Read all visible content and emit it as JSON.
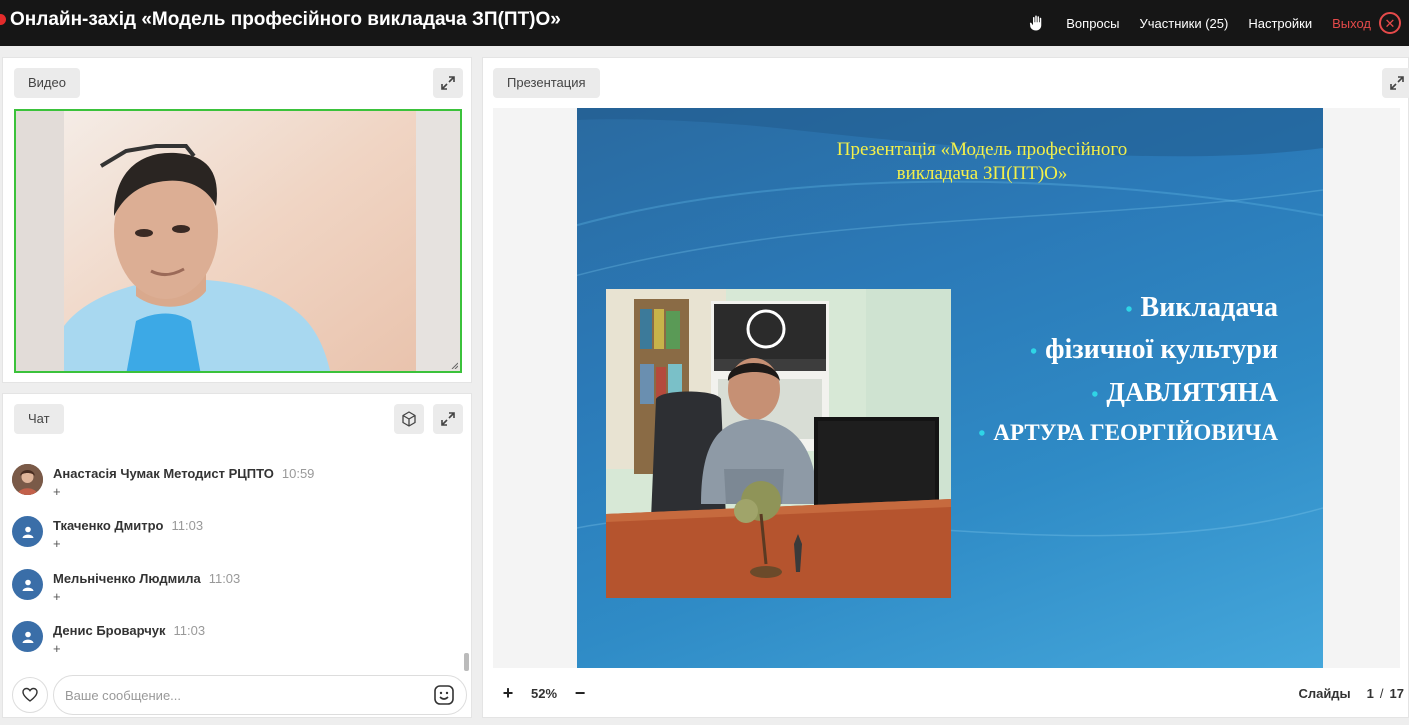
{
  "header": {
    "title": "Онлайн-захід «Модель професійного викладача ЗП(ПТ)О»",
    "nav": {
      "questions": "Вопросы",
      "participants": "Участники (25)",
      "settings": "Настройки",
      "exit": "Выход"
    }
  },
  "video": {
    "label": "Видео"
  },
  "chat": {
    "label": "Чат",
    "messages": [
      {
        "author": "Анастасія Чумак Методист РЦПТО",
        "time": "10:59",
        "text": "+",
        "avatar": "photo"
      },
      {
        "author": "Ткаченко Дмитро",
        "time": "11:03",
        "text": "+",
        "avatar": "user-icon"
      },
      {
        "author": "Мельніченко Людмила",
        "time": "11:03",
        "text": "+",
        "avatar": "user-icon"
      },
      {
        "author": "Денис Броварчук",
        "time": "11:03",
        "text": "+",
        "avatar": "user-icon"
      }
    ],
    "input_placeholder": "Ваше сообщение..."
  },
  "presentation": {
    "label": "Презентация",
    "slide": {
      "title_line1": "Презентація «Модель професійного",
      "title_line2": "викладача ЗП(ПТ)О»",
      "bullets": [
        "Викладача",
        "фізичної культури",
        "ДАВЛЯТЯНА",
        "АРТУРА ГЕОРГІЙОВИЧА"
      ]
    },
    "zoom": "52%",
    "slides_label": "Слайды",
    "current_slide": "1",
    "slide_separator": "/",
    "total_slides": "17"
  },
  "colors": {
    "topbar": "#161616",
    "exit": "#e54a4a",
    "active_video_border": "#3bc23b",
    "slide_title": "#f3f04a",
    "bullet_dot": "#2fd5e6"
  }
}
